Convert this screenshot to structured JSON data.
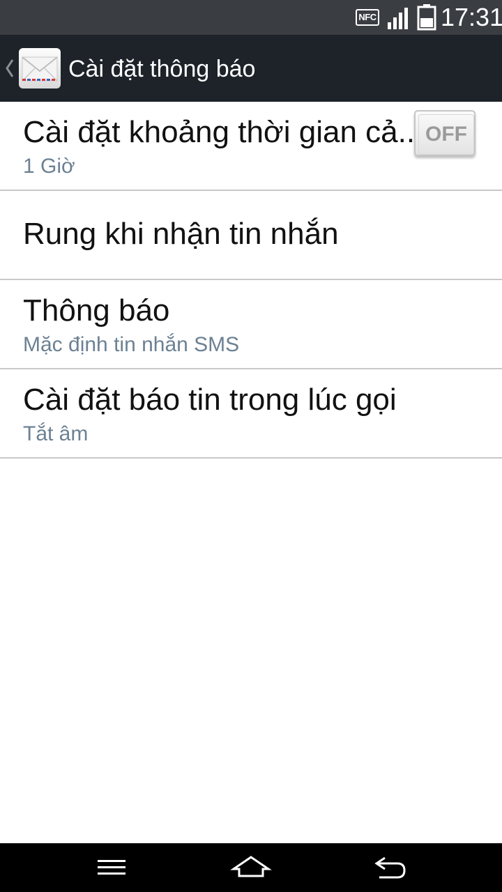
{
  "status_bar": {
    "nfc_label": "NFC",
    "time": "17:31",
    "icons": [
      "nfc-icon",
      "signal-icon",
      "battery-icon"
    ]
  },
  "action_bar": {
    "title": "Cài đặt thông báo",
    "app_icon": "envelope-icon",
    "back_icon": "chevron-left-icon"
  },
  "settings": {
    "items": [
      {
        "title": "Cài đặt khoảng thời gian cả...",
        "summary": "1 Giờ"
      },
      {
        "title": "Rung khi nhận tin nhắn",
        "toggle_label": "OFF",
        "toggle_state": "off"
      },
      {
        "title": "Thông báo",
        "summary": "Mặc định tin nhắn SMS"
      },
      {
        "title": "Cài đặt báo tin trong lúc gọi",
        "summary": "Tắt âm"
      }
    ]
  },
  "nav_bar": {
    "buttons": [
      "menu-icon",
      "home-icon",
      "back-icon"
    ]
  },
  "colors": {
    "status_bar_bg": "#3a3d42",
    "action_bar_bg": "#1d2329",
    "summary_text": "#6c8193",
    "divider": "#c9c9c9",
    "nav_bar_bg": "#000000"
  }
}
